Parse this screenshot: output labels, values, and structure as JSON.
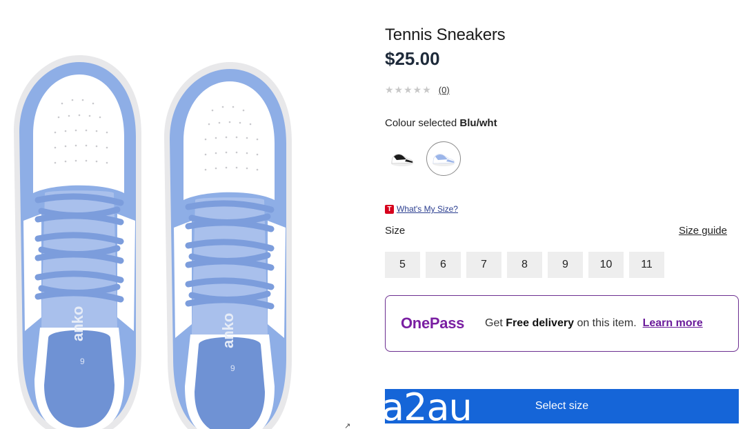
{
  "product": {
    "title": "Tennis Sneakers",
    "price": "$25.00",
    "rating_stars": "★★★★★",
    "review_count": "(0)",
    "insole_brand": "anko",
    "insole_size": "9"
  },
  "colour": {
    "label": "Colour selected",
    "value": "Blu/wht",
    "options": [
      "black-white",
      "blue-white"
    ],
    "selected_index": 1
  },
  "size": {
    "whats_my_size_logo": "T",
    "whats_my_size": "What's My Size?",
    "label": "Size",
    "guide": "Size guide",
    "options": [
      "5",
      "6",
      "7",
      "8",
      "9",
      "10",
      "11"
    ]
  },
  "onepass": {
    "logo": "OnePass",
    "text_prefix": "Get",
    "text_bold": "Free delivery",
    "text_suffix": "on this item.",
    "link": "Learn more"
  },
  "cta": {
    "label": "Select size",
    "overlay_text": "a2au"
  },
  "colors": {
    "accent_blue": "#1565d8",
    "onepass_purple": "#7a1fa2",
    "shoe_blue": "#8eaee6",
    "price_color": "#1e2a3a"
  },
  "icons": {
    "expand": "expand-icon",
    "target_logo": "target-logo-icon"
  }
}
